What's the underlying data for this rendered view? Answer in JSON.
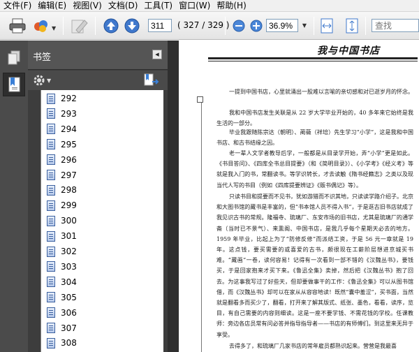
{
  "menu": [
    "文件(F)",
    "编辑(E)",
    "视图(V)",
    "文档(D)",
    "工具(T)",
    "窗口(W)",
    "帮助(H)"
  ],
  "toolbar": {
    "page_current": "311",
    "page_total": "( 327 / 329 )",
    "zoom": "36.9%",
    "search_placeholder": "查找"
  },
  "panel": {
    "title": "书签"
  },
  "bookmarks": [
    "292",
    "293",
    "294",
    "295",
    "296",
    "297",
    "298",
    "299",
    "300",
    "301",
    "302",
    "303",
    "304",
    "305",
    "306",
    "307",
    "308"
  ],
  "document": {
    "title": "我与中国书店",
    "paragraphs": [
      "一提到中国书店，心里就涌出一股难以言喻的亲切感和对已逝岁月的怀念。",
      "我和中国书店发生关联是从 22 岁大学毕业开始的，40 多年来它始终是我生活的一部分。",
      "毕业我跟随陈宗达（朝明）、蔺薇（祥培）先生学习“小学”，这是我和中国书店、和古书结缘之因。",
      "老一辈人文学者教导后学，一般都是从目录学开始，弄“小学”更是如此。《书目答问》、《四库全书总目提要》（和《简明目录》）、《小学考》《经义考》等就是我入门的书，常翻读书。等学识转长，才去读触《隋书经籍志》之类以及现当代人写的书目（例如《四库提要辨证》《贩书偶记》等）。",
      "只读书目和提要而不见书，犹如游猎而不识其地，只读读学路介绍子。北京和大图书馆的藏书是丰富的，但“书本馆人员不得入书”，于是逛古旧书店就成了我见识古书的常规。隆福寺、琉璃厂、东安市场的旧书店，尤其是琉璃厂的通学斋（当时已不景气）、来熏阁、中国书店，是我几乎每个星期天必去的地方。1959 年毕业，比起上为了“防修反修”而派结工资，于是 56 元一章就是 19 年。这点钱，要买需要的或喜爱的古书，颇很现在工薪阶层想进京城买书难。“藏画”一卷，读何容易！记得有一次看到一部不错的《汉魏丛书》，要钱买，于是回家抱来才买下来。《鲁迅全集》卖掉，然后把《汉魏丛书》抱了回去。为这事我写过了好些天，但却要做事干的工作：《鲁迅全集》可以从图书馆借，而《汉魏丛书》却可以在家从从容容地读！既然“囊中羞涩”，买书面，当然就是翻看多而买少了，翻看，打开来了解其版式、纸张、墨色，看看，读序，览目，有自己需要的内容则细读。这是一座不要学钱、不需花钱的学校。任课教师：旁边各店员常有问必答并指导指导者——书店的有师傅们。到这里来无异于享受。",
      "去得多了，和琉璃厂几家书店的常年雇员都熟识起来。营营是我最喜"
    ]
  }
}
